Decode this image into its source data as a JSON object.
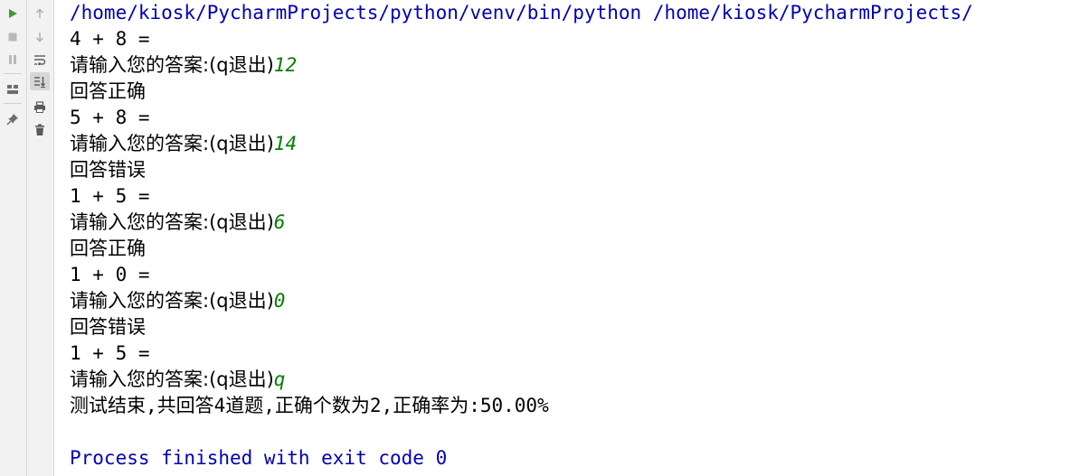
{
  "toolbar": {
    "left_icons": [
      "run-icon",
      "stop-icon",
      "pause-icon",
      "layout-icon",
      "pin-icon"
    ],
    "right_icons": [
      "up-arrow-icon",
      "down-arrow-icon",
      "soft-wrap-icon",
      "scroll-to-end-icon",
      "print-icon",
      "trash-icon"
    ]
  },
  "console": {
    "command": "/home/kiosk/PycharmProjects/python/venv/bin/python /home/kiosk/PycharmProjects/",
    "prompt": "请输入您的答案:(q退出)",
    "rounds": [
      {
        "question": "4 + 8 =",
        "answer": "12",
        "result": "回答正确"
      },
      {
        "question": "5 + 8 =",
        "answer": "14",
        "result": "回答错误"
      },
      {
        "question": "1 + 5 =",
        "answer": "6",
        "result": "回答正确"
      },
      {
        "question": "1 + 0 =",
        "answer": "0",
        "result": "回答错误"
      }
    ],
    "final_question": "1 + 5 =",
    "final_answer": "q",
    "summary": "测试结束,共回答4道题,正确个数为2,正确率为:50.00%",
    "exit_message": "Process finished with exit code 0"
  },
  "colors": {
    "input_text": "#008000",
    "system_text": "#0000b4",
    "gutter_bg": "#f2f2f2"
  }
}
